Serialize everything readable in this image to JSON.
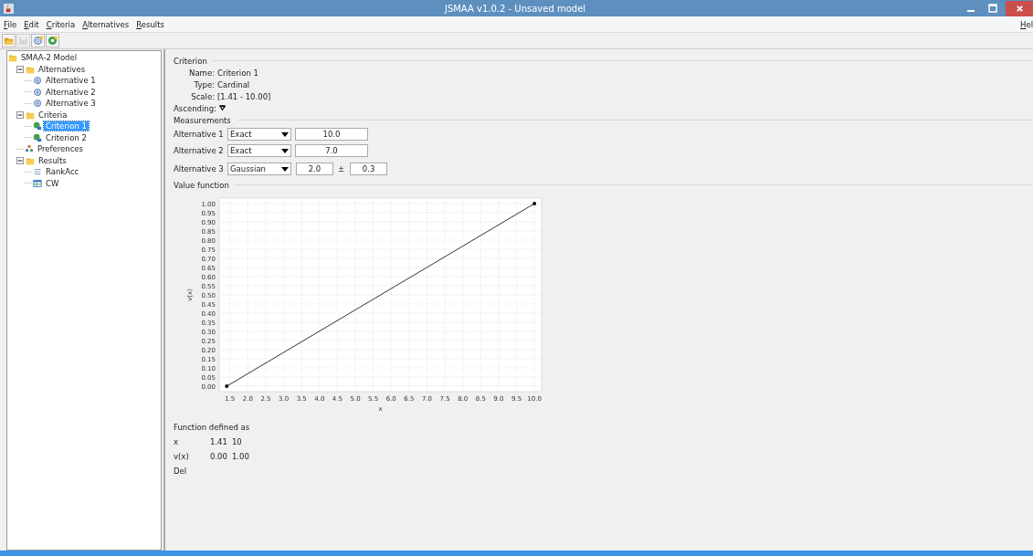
{
  "window": {
    "title": "JSMAA v1.0.2 - Unsaved model"
  },
  "menu": [
    {
      "label": "File"
    },
    {
      "label": "Edit"
    },
    {
      "label": "Criteria"
    },
    {
      "label": "Alternatives"
    },
    {
      "label": "Results"
    }
  ],
  "menu_right": "Hel",
  "toolbar": [
    {
      "kind": "open",
      "disabled": false
    },
    {
      "kind": "save",
      "disabled": true
    },
    {
      "kind": "add-alternative",
      "disabled": false
    },
    {
      "kind": "add-criterion",
      "disabled": false
    }
  ],
  "tree": [
    {
      "label": "SMAA-2 Model",
      "kind": "folder",
      "selected": false,
      "children": [
        {
          "label": "Alternatives",
          "kind": "folder",
          "selected": false,
          "expanded": true,
          "children": [
            {
              "label": "Alternative 1",
              "kind": "alternative",
              "selected": false
            },
            {
              "label": "Alternative 2",
              "kind": "alternative",
              "selected": false
            },
            {
              "label": "Alternative 3",
              "kind": "alternative",
              "selected": false
            }
          ]
        },
        {
          "label": "Criteria",
          "kind": "folder",
          "selected": false,
          "expanded": true,
          "children": [
            {
              "label": "Criterion 1",
              "kind": "criterion",
              "selected": true
            },
            {
              "label": "Criterion 2",
              "kind": "criterion",
              "selected": false
            }
          ]
        },
        {
          "label": "Preferences",
          "kind": "preferences",
          "selected": false
        },
        {
          "label": "Results",
          "kind": "folder",
          "selected": false,
          "expanded": true,
          "children": [
            {
              "label": "RankAcc",
              "kind": "list",
              "selected": false
            },
            {
              "label": "CW",
              "kind": "table",
              "selected": false
            }
          ]
        }
      ]
    }
  ],
  "criterion": {
    "heading": "Criterion",
    "fields": [
      {
        "label": "Name:",
        "value": "Criterion 1"
      },
      {
        "label": "Type:",
        "value": "Cardinal"
      },
      {
        "label": "Scale:",
        "value": "[1.41 - 10.00]"
      }
    ],
    "ascending": {
      "label": "Ascending:",
      "checked": true
    }
  },
  "measurements": {
    "heading": "Measurements",
    "rows": [
      {
        "label": "Alternative 1",
        "kind": "exact",
        "method": "Exact",
        "value": "10.0"
      },
      {
        "label": "Alternative 2",
        "kind": "exact",
        "method": "Exact",
        "value": "7.0"
      },
      {
        "label": "Alternative 3",
        "kind": "gaussian",
        "method": "Gaussian",
        "mean": "2.0",
        "pm": "±",
        "std": "0.3"
      }
    ]
  },
  "value_function": {
    "heading": "Value function",
    "chart_data": {
      "type": "line",
      "xlabel": "x",
      "ylabel": "v(x)",
      "x": [
        1.41,
        10
      ],
      "series": [
        {
          "color": "#333333",
          "values": [
            0,
            1
          ]
        }
      ],
      "xlim": [
        1.2,
        10.2
      ],
      "ylim": [
        -0.03,
        1.03
      ],
      "grid": true,
      "xticks": [
        1.5,
        {
          "value": 2,
          "label": "2.0"
        },
        2.5,
        {
          "value": 3,
          "label": "3.0"
        },
        3.5,
        {
          "value": 4,
          "label": "4.0"
        },
        4.5,
        {
          "value": 5,
          "label": "5.0"
        },
        5.5,
        {
          "value": 6,
          "label": "6.0"
        },
        6.5,
        {
          "value": 7,
          "label": "7.0"
        },
        7.5,
        {
          "value": 8,
          "label": "8.0"
        },
        8.5,
        {
          "value": 9,
          "label": "9.0"
        },
        9.5,
        {
          "value": 10,
          "label": "10.0"
        }
      ],
      "yticks": [
        {
          "value": 0,
          "label": "0.00"
        },
        0.05,
        {
          "value": 0.1,
          "label": "0.10"
        },
        0.15,
        {
          "value": 0.2,
          "label": "0.20"
        },
        0.25,
        {
          "value": 0.3,
          "label": "0.30"
        },
        0.35,
        {
          "value": 0.4,
          "label": "0.40"
        },
        0.45,
        {
          "value": 0.5,
          "label": "0.50"
        },
        0.55,
        {
          "value": 0.6,
          "label": "0.60"
        },
        0.65,
        {
          "value": 0.7,
          "label": "0.70"
        },
        0.75,
        {
          "value": 0.8,
          "label": "0.80"
        },
        0.85,
        {
          "value": 0.9,
          "label": "0.90"
        },
        0.95,
        {
          "value": 1,
          "label": "1.00"
        }
      ]
    }
  },
  "definition": {
    "heading": "Function defined as",
    "rows": [
      {
        "label": "x",
        "values": [
          "1.41",
          "10"
        ]
      },
      {
        "label": "v(x)",
        "values": [
          "0.00",
          "1.00"
        ]
      }
    ],
    "delete": "Del"
  }
}
